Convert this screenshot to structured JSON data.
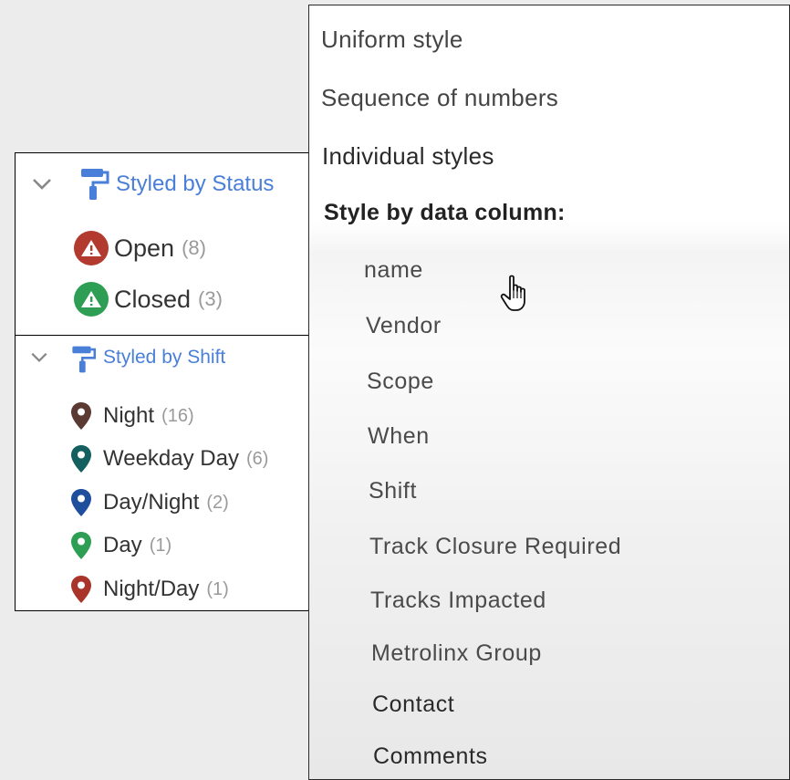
{
  "status_layer": {
    "title": "Styled by Status",
    "items": [
      {
        "label": "Open",
        "count": "(8)",
        "color": "#b23a2e"
      },
      {
        "label": "Closed",
        "count": "(3)",
        "color": "#2e9e54"
      }
    ]
  },
  "shift_layer": {
    "title": "Styled by Shift",
    "items": [
      {
        "label": "Night",
        "count": "(16)",
        "color": "#5a3a33"
      },
      {
        "label": "Weekday Day",
        "count": "(6)",
        "color": "#145f5f"
      },
      {
        "label": "Day/Night",
        "count": "(2)",
        "color": "#1f4f9c"
      },
      {
        "label": "Day",
        "count": "(1)",
        "color": "#2e9e54"
      },
      {
        "label": "Night/Day",
        "count": "(1)",
        "color": "#a8342a"
      }
    ]
  },
  "style_menu": {
    "options": [
      "Uniform style",
      "Sequence of numbers",
      "Individual styles"
    ],
    "column_heading": "Style by data column:",
    "columns": [
      "name",
      "Vendor",
      "Scope",
      "When",
      "Shift",
      "Track Closure Required",
      "Tracks Impacted",
      "Metrolinx Group",
      "Contact",
      "Comments"
    ]
  },
  "colors": {
    "accent_blue": "#4a7fd9"
  }
}
